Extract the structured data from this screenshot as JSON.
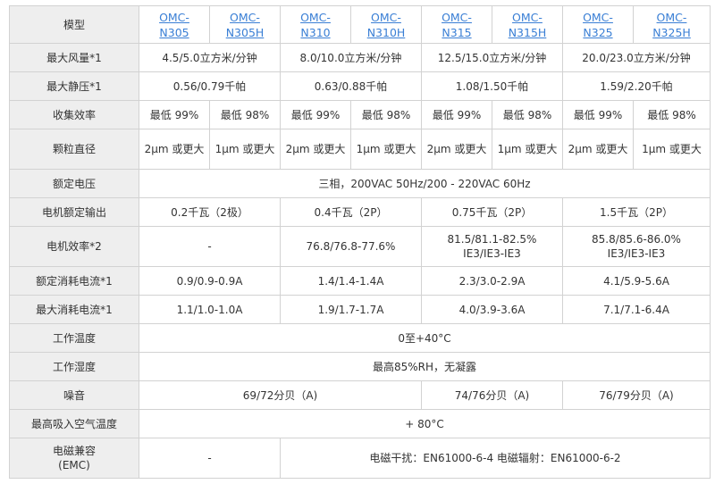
{
  "table": {
    "corner_label": "模型",
    "models": [
      {
        "l1": "OMC-",
        "l2": "N305"
      },
      {
        "l1": "OMC-",
        "l2": "N305H"
      },
      {
        "l1": "OMC-",
        "l2": "N310"
      },
      {
        "l1": "OMC-",
        "l2": "N310H"
      },
      {
        "l1": "OMC-",
        "l2": "N315"
      },
      {
        "l1": "OMC-",
        "l2": "N315H"
      },
      {
        "l1": "OMC-",
        "l2": "N325"
      },
      {
        "l1": "OMC-",
        "l2": "N325H"
      }
    ],
    "rows": {
      "airflow": {
        "label": "最大风量*1",
        "v": [
          "4.5/5.0立方米/分钟",
          "8.0/10.0立方米/分钟",
          "12.5/15.0立方米/分钟",
          "20.0/23.0立方米/分钟"
        ]
      },
      "static_pressure": {
        "label": "最大静压*1",
        "v": [
          "0.56/0.79千帕",
          "0.63/0.88千帕",
          "1.08/1.50千帕",
          "1.59/2.20千帕"
        ]
      },
      "efficiency": {
        "label": "收集效率",
        "v": [
          "最低 99%",
          "最低 98%",
          "最低 99%",
          "最低 98%",
          "最低 99%",
          "最低 98%",
          "最低 99%",
          "最低 98%"
        ]
      },
      "particle": {
        "label": "颗粒直径",
        "v": [
          "2μm 或更大",
          "1μm 或更大",
          "2μm 或更大",
          "1μm 或更大",
          "2μm 或更大",
          "1μm 或更大",
          "2μm 或更大",
          "1μm 或更大"
        ]
      },
      "voltage": {
        "label": "额定电压",
        "v": "三相，200VAC 50Hz/200 - 220VAC 60Hz"
      },
      "motor_output": {
        "label": "电机额定输出",
        "v": [
          "0.2千瓦（2极）",
          "0.4千瓦（2P）",
          "0.75千瓦（2P）",
          "1.5千瓦（2P）"
        ]
      },
      "motor_eff": {
        "label": "电机效率*2",
        "v": [
          {
            "a": "-",
            "b": ""
          },
          {
            "a": "76.8/76.8-77.6%",
            "b": ""
          },
          {
            "a": "81.5/81.1-82.5%",
            "b": "IE3/IE3-IE3"
          },
          {
            "a": "85.8/85.6-86.0%",
            "b": "IE3/IE3-IE3"
          }
        ]
      },
      "rated_current": {
        "label": "额定消耗电流*1",
        "v": [
          "0.9/0.9-0.9A",
          "1.4/1.4-1.4A",
          "2.3/3.0-2.9A",
          "4.1/5.9-5.6A"
        ]
      },
      "max_current": {
        "label": "最大消耗电流*1",
        "v": [
          "1.1/1.0-1.0A",
          "1.9/1.7-1.7A",
          "4.0/3.9-3.6A",
          "7.1/7.1-6.4A"
        ]
      },
      "op_temp": {
        "label": "工作温度",
        "v": "0至+40°C"
      },
      "op_humidity": {
        "label": "工作湿度",
        "v": "最高85%RH，无凝露"
      },
      "noise": {
        "label": "噪音",
        "v": [
          "69/72分贝（A)",
          "74/76分贝（A)",
          "76/79分贝（A)"
        ]
      },
      "intake_temp": {
        "label": "最高吸入空气温度",
        "v": "+ 80°C"
      },
      "emc": {
        "label_1": "电磁兼容",
        "label_2": "(EMC)",
        "v": [
          "-",
          "电磁干扰：EN61000-6-4 电磁辐射：EN61000-6-2"
        ]
      }
    }
  },
  "colors": {
    "header_bg": "#eeeeee",
    "border": "#d2d2d2",
    "link": "#3a7fd5",
    "text": "#333333"
  }
}
